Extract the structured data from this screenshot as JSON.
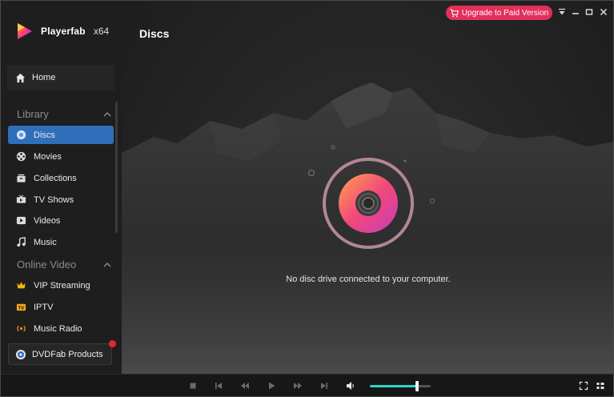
{
  "app": {
    "name": "Playerfab",
    "arch": "x64"
  },
  "header": {
    "upgrade_label": "Upgrade to Paid Version"
  },
  "sidebar": {
    "home": "Home",
    "library": {
      "title": "Library",
      "items": [
        {
          "label": "Discs",
          "icon": "disc-icon",
          "active": true
        },
        {
          "label": "Movies",
          "icon": "film-reel-icon"
        },
        {
          "label": "Collections",
          "icon": "collections-icon"
        },
        {
          "label": "TV Shows",
          "icon": "tv-icon"
        },
        {
          "label": "Videos",
          "icon": "video-play-icon"
        },
        {
          "label": "Music",
          "icon": "music-note-icon"
        }
      ]
    },
    "online": {
      "title": "Online Video",
      "items": [
        {
          "label": "VIP Streaming",
          "icon": "crown-icon"
        },
        {
          "label": "IPTV",
          "icon": "iptv-icon"
        },
        {
          "label": "Music Radio",
          "icon": "radio-icon"
        }
      ]
    },
    "products": "DVDFab Products"
  },
  "main": {
    "title": "Discs",
    "empty_message": "No disc drive connected to your computer."
  },
  "player": {
    "volume_percent": 77
  },
  "colors": {
    "accent": "#2f6fba",
    "upgrade": "#e2305b",
    "volume": "#2fd4c4",
    "badge": "#e8262f"
  }
}
